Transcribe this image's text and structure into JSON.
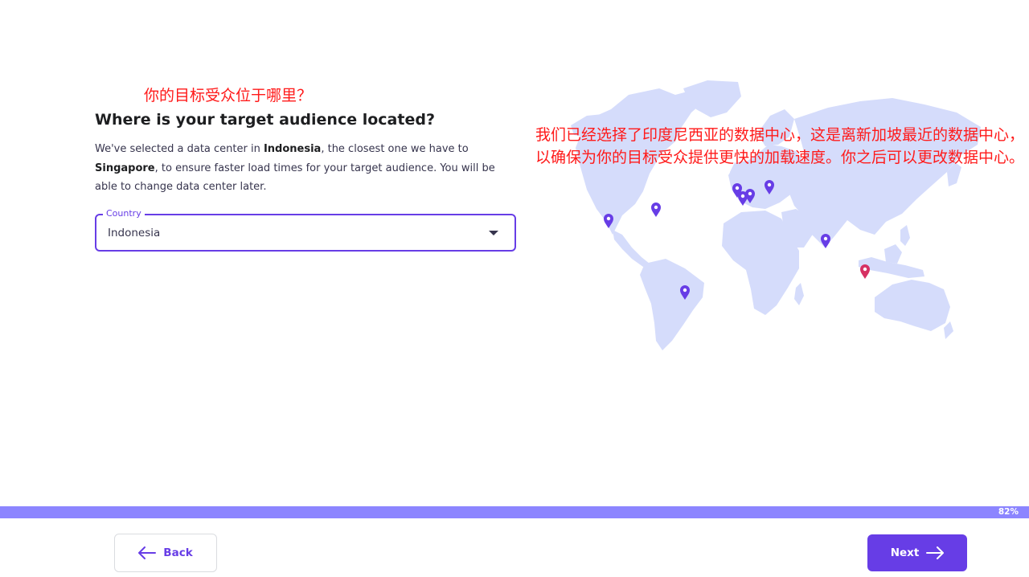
{
  "annotations": {
    "question_zh": "你的目标受众位于哪里？",
    "note_zh": "我们已经选择了印度尼西亚的数据中心，这是离新加坡最近的数据中心，以确保为你的目标受众提供更快的加载速度。你之后可以更改数据中心。"
  },
  "main": {
    "heading": "Where is your target audience located?",
    "description": {
      "part1": "We've selected a data center in ",
      "country": "Indonesia",
      "part2": ", the closest one we have to ",
      "city": "Singapore",
      "part3": ", to ensure faster load times for your target audience. You will be able to change data center later."
    },
    "country_select": {
      "label": "Country",
      "value": "Indonesia",
      "icon": "caret-down-icon"
    }
  },
  "map": {
    "icon": "world-map",
    "land_color": "#d5dcfb",
    "pin_color": "#673de6",
    "selected_pin_color": "#d63163",
    "pins": [
      {
        "name": "us-west"
      },
      {
        "name": "us-east"
      },
      {
        "name": "brazil"
      },
      {
        "name": "uk"
      },
      {
        "name": "france"
      },
      {
        "name": "netherlands"
      },
      {
        "name": "lithuania"
      },
      {
        "name": "india"
      },
      {
        "name": "indonesia",
        "selected": true
      }
    ]
  },
  "progress": {
    "percent": 82,
    "label": "82%",
    "color": "#8c85ff"
  },
  "footer": {
    "back_label": "Back",
    "back_icon": "arrow-left-icon",
    "next_label": "Next",
    "next_icon": "arrow-right-icon",
    "accent": "#673de6"
  }
}
